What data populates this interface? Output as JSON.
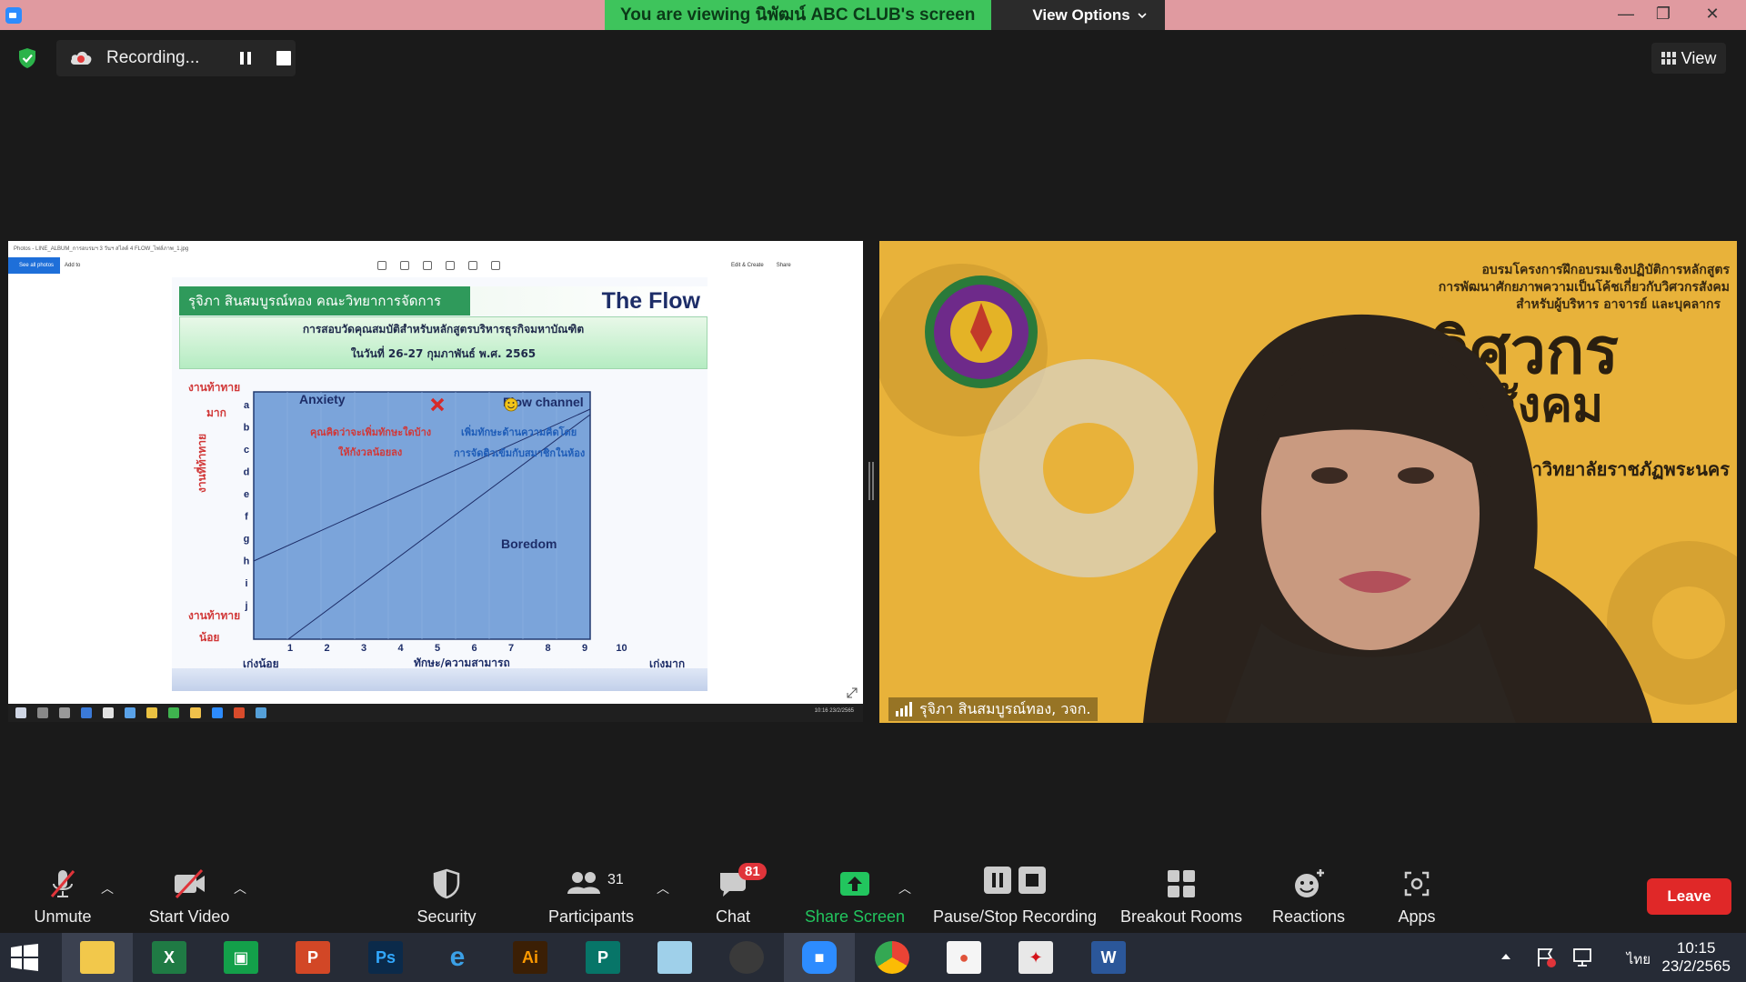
{
  "titlebar": {
    "banner_text": "You are viewing นิพัฒน์ ABC CLUB's screen",
    "view_options": "View Options",
    "minimize": "—",
    "restore": "❐",
    "close": "✕"
  },
  "status": {
    "recording_label": "Recording...",
    "view_label": "View"
  },
  "shared_screen": {
    "window_title": "Photos - LINE_ALBUM_การอบรมฯ 3 วันฯ สไลด์ 4 FLOW_ไฟล์ภาพ_1.jpg",
    "see_all_photos": "See all photos",
    "add_to": "Add to",
    "edit_create": "Edit & Create",
    "share": "Share",
    "taskbar_tray": "10:16 23/2/2565",
    "slide": {
      "author": "รุจิภา สินสมบูรณ์ทอง คณะวิทยาการจัดการ",
      "title": "The Flow",
      "subtitle_line1": "การสอบวัดคุณสมบัติสำหรับหลักสูตรบริหารธุรกิจมหาบัณฑิต",
      "subtitle_line2": "ในวันที่ 26-27 กุมภาพันธ์ พ.ศ. 2565",
      "y_high_label1": "งานท้าทาย",
      "y_high_label2": "มาก",
      "y_low_label1": "งานท้าทาย",
      "y_low_label2": "น้อย",
      "y_axis_title": "งานที่ท้าทาย",
      "x_low_label": "เก่งน้อย",
      "x_axis_title": "ทักษะ/ความสามารถ",
      "x_high_label": "เก่งมาก",
      "anxiety": "Anxiety",
      "flow_channel": "Flow channel",
      "boredom": "Boredom",
      "anxiety_note1": "คุณคิดว่าจะเพิ่มทักษะใดบ้าง",
      "anxiety_note2": "ให้กังวลน้อยลง",
      "flow_note1": "เพิ่มทักษะด้านความคิดโดย",
      "flow_note2": "การจัดติวเข้มกับสมาชิกในห้อง"
    }
  },
  "chart_data": {
    "type": "line",
    "title": "The Flow",
    "xlabel": "ทักษะ/ความสามารถ",
    "ylabel": "งานที่ท้าทาย",
    "x_ticks": [
      "1",
      "2",
      "3",
      "4",
      "5",
      "6",
      "7",
      "8",
      "9",
      "10"
    ],
    "y_ticks": [
      "a",
      "b",
      "c",
      "d",
      "e",
      "f",
      "g",
      "h",
      "i",
      "j"
    ],
    "regions": [
      "Anxiety",
      "Flow channel",
      "Boredom"
    ],
    "markers": [
      {
        "symbol": "cross",
        "color": "#d62a2a",
        "x": 5,
        "y_tick": "a"
      },
      {
        "symbol": "smiley",
        "color": "#f2c418",
        "x": 7,
        "y_tick": "a"
      }
    ]
  },
  "video": {
    "participant_name": "รุจิภา สินสมบูรณ์ทอง, วจก.",
    "bg_header_line1": "อบรมโครงการฝึกอบรมเชิงปฏิบัติการหลักสูตร",
    "bg_header_line2": "การพัฒนาศักยภาพความเป็นโค้ชเกี่ยวกับวิศวกรสังคม",
    "bg_header_line3": "สำหรับผู้บริหาร อาจารย์ และบุคลากร",
    "bg_big_word1": "วิศวกร",
    "bg_big_word2": "สังคม",
    "bg_university": "มหาวิทยาลัยราชภัฏพระนคร"
  },
  "toolbar": {
    "unmute": "Unmute",
    "start_video": "Start Video",
    "security": "Security",
    "participants": "Participants",
    "participants_count": "31",
    "chat": "Chat",
    "chat_badge": "81",
    "share_screen": "Share Screen",
    "pause_stop": "Pause/Stop Recording",
    "breakout": "Breakout Rooms",
    "reactions": "Reactions",
    "apps": "Apps",
    "leave": "Leave"
  },
  "taskbar": {
    "apps": [
      "File Explorer",
      "Excel",
      "Store",
      "PowerPoint",
      "Photoshop",
      "Internet Explorer",
      "Illustrator",
      "Publisher",
      "Notepad",
      "PhotoScape",
      "Zoom",
      "Chrome",
      "Paint",
      "Acrobat",
      "Word"
    ],
    "language": "ไทย",
    "time": "10:15",
    "date": "23/2/2565"
  },
  "colors": {
    "title_bar": "#e09aa0",
    "banner_green": "#3ec45c",
    "share_green": "#22c55e",
    "leave_red": "#e02828",
    "slide_blue": "#7ba4da",
    "video_bg": "#e8b23a"
  }
}
